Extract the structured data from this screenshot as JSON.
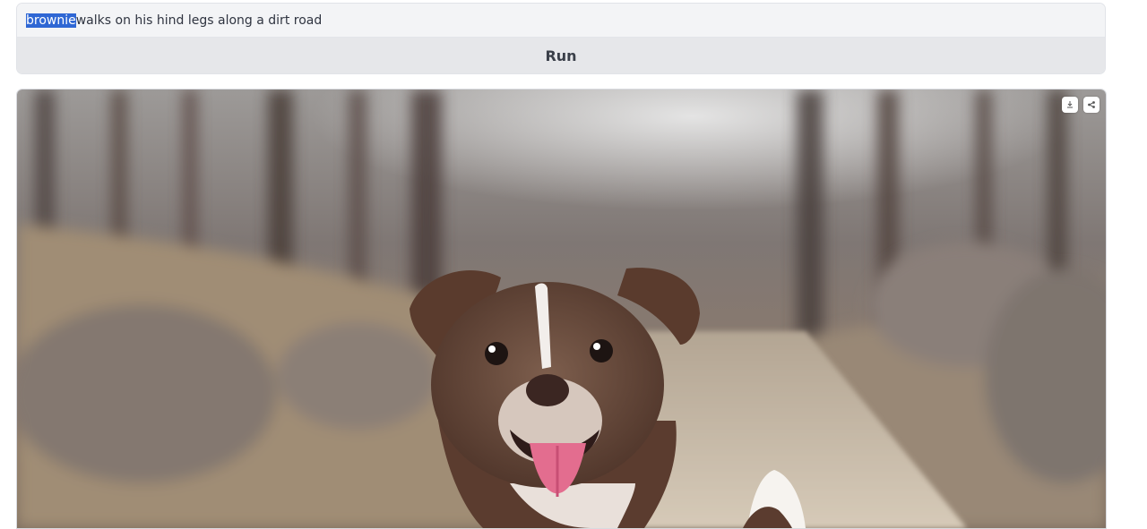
{
  "prompt": {
    "selected_word": "brownie",
    "rest_text": " walks on his hind legs along a dirt road"
  },
  "run_button": {
    "label": "Run"
  },
  "output_image": {
    "subject": "brown dog with white chest walking on dirt road in blurred winter woods",
    "actions": [
      "download-icon",
      "share-icon"
    ]
  },
  "colors": {
    "selection": "#2f67d4",
    "panel_bg": "#f2f3f5",
    "button_bg": "#e6e7ea",
    "text": "#2f3440"
  }
}
